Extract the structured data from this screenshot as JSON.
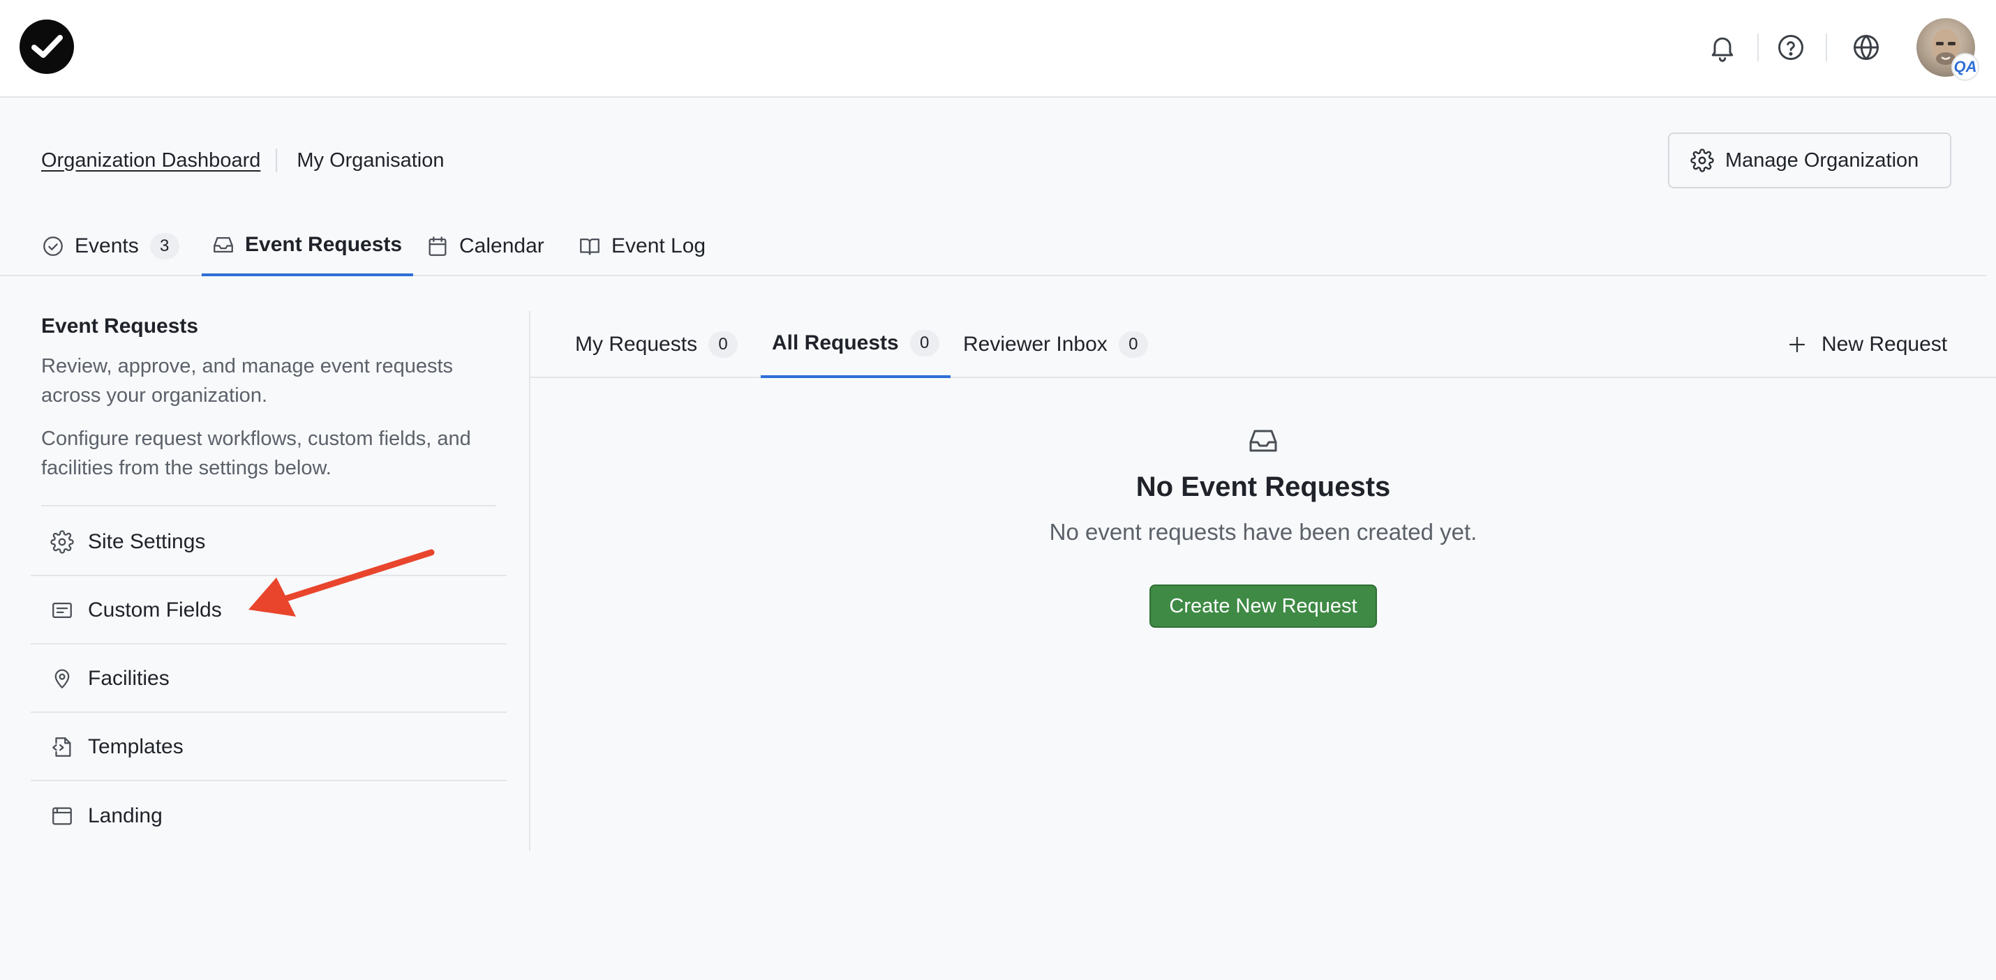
{
  "topbar": {
    "logo_icon": "checkmark-logo",
    "icons": [
      "bell-icon",
      "help-circle-icon",
      "globe-icon"
    ],
    "avatar_badge": "QA"
  },
  "breadcrumb": {
    "link": "Organization Dashboard",
    "current": "My Organisation"
  },
  "manage_button": {
    "label": "Manage Organization",
    "icon": "gear-icon"
  },
  "main_tabs": [
    {
      "label": "Events",
      "count": "3",
      "icon": "check-circle-icon"
    },
    {
      "label": "Event Requests",
      "icon": "inbox-icon",
      "active": true
    },
    {
      "label": "Calendar",
      "icon": "calendar-icon"
    },
    {
      "label": "Event Log",
      "icon": "book-icon"
    }
  ],
  "sidebar": {
    "title": "Event Requests",
    "desc1": "Review, approve, and manage event requests across your organization.",
    "desc2": "Configure request workflows, custom fields, and facilities from the settings below.",
    "items": [
      {
        "label": "Site Settings",
        "icon": "gear-icon"
      },
      {
        "label": "Custom Fields",
        "icon": "form-field-icon"
      },
      {
        "label": "Facilities",
        "icon": "map-pin-icon"
      },
      {
        "label": "Templates",
        "icon": "file-code-icon"
      },
      {
        "label": "Landing",
        "icon": "browser-window-icon"
      }
    ]
  },
  "sub_tabs": [
    {
      "label": "My Requests",
      "count": "0"
    },
    {
      "label": "All Requests",
      "count": "0",
      "active": true
    },
    {
      "label": "Reviewer Inbox",
      "count": "0"
    }
  ],
  "new_request": {
    "label": "New Request",
    "icon": "plus-icon"
  },
  "empty_state": {
    "icon": "inbox-icon",
    "title": "No Event Requests",
    "description": "No event requests have been created yet.",
    "button": "Create New Request"
  },
  "colors": {
    "accent": "#2f6fd6",
    "primary_button": "#3f8a45",
    "annotation_arrow": "#e8452c"
  }
}
